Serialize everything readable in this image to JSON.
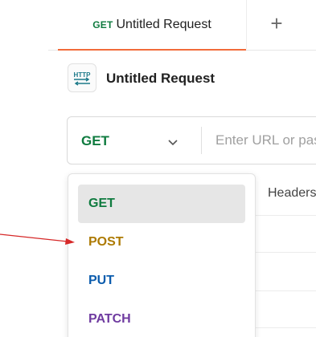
{
  "tab": {
    "method": "GET",
    "title": "Untitled Request",
    "add_symbol": "+"
  },
  "request": {
    "title": "Untitled Request",
    "icon_text": "HTTP"
  },
  "url_bar": {
    "method": "GET",
    "placeholder": "Enter URL or paste text"
  },
  "background": {
    "headers_label": "Headers"
  },
  "method_dropdown": {
    "options": [
      {
        "label": "GET",
        "color": "#0f7b3f",
        "selected": true
      },
      {
        "label": "POST",
        "color": "#ad7a03",
        "selected": false
      },
      {
        "label": "PUT",
        "color": "#0b5cad",
        "selected": false
      },
      {
        "label": "PATCH",
        "color": "#6f3ba0",
        "selected": false
      }
    ]
  },
  "colors": {
    "active_tab_underline": "#f26b3a",
    "annotation_arrow": "#d62828"
  }
}
